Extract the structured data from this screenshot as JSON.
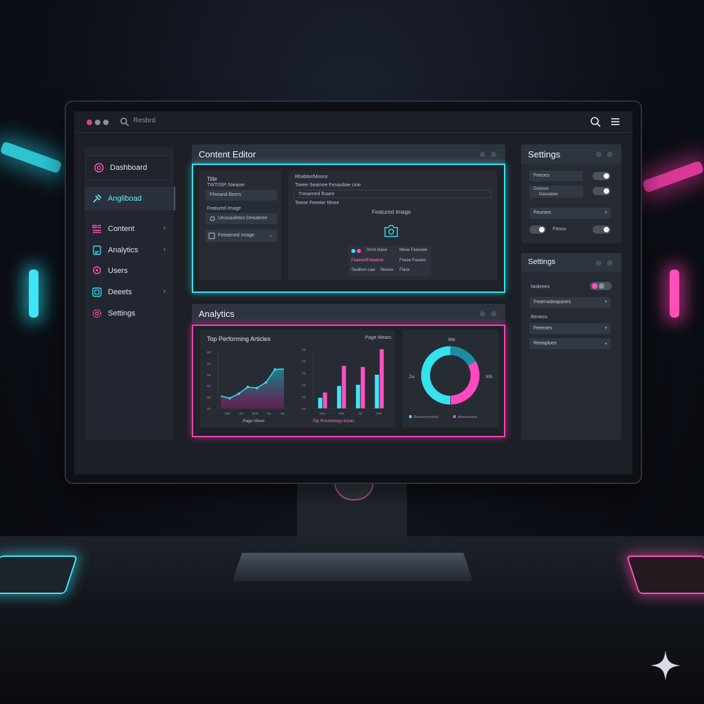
{
  "window": {
    "search_text": "Resbrd",
    "dot_colors": [
      "#d2457f",
      "#8a8f99",
      "#8a8f99"
    ]
  },
  "sidebar": {
    "items": [
      {
        "label": "Dashboard",
        "icon": "shield-icon"
      },
      {
        "label": "Angliboad",
        "icon": "pin-icon"
      },
      {
        "label": "Content",
        "icon": "content-icon"
      },
      {
        "label": "Analytics",
        "icon": "document-icon"
      },
      {
        "label": "Users",
        "icon": "user-icon"
      },
      {
        "label": "Deeets",
        "icon": "box-icon"
      },
      {
        "label": "Settings",
        "icon": "gear-icon"
      }
    ]
  },
  "content_editor": {
    "title": "Content Editor",
    "controls": "◎ ◎",
    "left": {
      "title_label": "Title",
      "title_value": "TWT0SP /loeaser",
      "field1": "Ffeeand Beers",
      "featured_label": "Featured Image",
      "field2": "Ueosauleton Deeateee",
      "field3": "Feeaened Image"
    },
    "right": {
      "header": "Rbabtor/Mooce",
      "line1": "Toeee Searnee Fenaubae cioe",
      "line2": "Tneaened fluaee",
      "line3": "Teeoe Feeeier Mnee",
      "featured_image": "Featured Image",
      "mini_table": [
        [
          "",
          "Srom Nase",
          "Mnee Feeoaee"
        ],
        [
          "Feaeeen",
          "Feeeenie",
          "Fneee Fauees"
        ],
        [
          "Sealbon ciae",
          "Slenoa",
          "Flaoe"
        ]
      ]
    }
  },
  "analytics": {
    "title": "Analytics",
    "controls": "◎ ◎"
  },
  "chart_data": [
    {
      "type": "line",
      "title": "Top Performing Articles",
      "xlabel": "Page Views",
      "x": [
        "oun",
        "ou",
        "wou",
        "ou",
        "ou"
      ],
      "y_ticks": [
        "ws",
        "oo",
        "ou",
        "oo",
        "ou",
        "oo"
      ],
      "values": [
        22,
        18,
        26,
        38,
        36,
        46,
        69,
        70
      ],
      "ylim": [
        0,
        100
      ],
      "color": "#36d9ec"
    },
    {
      "type": "bar",
      "title": "Page Wears",
      "xlabel": "Top Rocoteeeyy tntses",
      "categories": [
        "oou",
        "oou",
        "ou",
        "ooe"
      ],
      "y_ticks": [
        "ou",
        "oo",
        "ou",
        "ou",
        "ou",
        "ou"
      ],
      "series": [
        {
          "values": [
            18,
            38,
            40,
            57
          ]
        },
        {
          "values": [
            27,
            72,
            70,
            100
          ]
        }
      ],
      "ylim": [
        0,
        100
      ],
      "colors": [
        "#3fe6f5",
        "#ff4fc0"
      ]
    },
    {
      "type": "pie",
      "labels_outside": [
        "966",
        "Zio",
        "305"
      ],
      "slices": [
        {
          "name": "Bneeeeroeseb",
          "value": 50,
          "color": "#36e1f0"
        },
        {
          "name": "Aeeoeeeoe",
          "value": 33,
          "color": "#ff49c0"
        },
        {
          "name": "",
          "value": 17,
          "color": "#1c8ca2"
        }
      ]
    }
  ],
  "settings_top": {
    "title": "Settings",
    "controls": "◎ ◎",
    "rows": [
      {
        "label": "Feeoes",
        "state": "on"
      },
      {
        "label": "Dsreoxs",
        "sub": "Deecabee",
        "state": "on"
      },
      {
        "label": "Feuroes",
        "select": true
      },
      {
        "label": "Feoos",
        "state": "on"
      }
    ]
  },
  "settings_bottom": {
    "title": "Settings",
    "controls": "◎ ◎",
    "toggle_label": "Notleees",
    "select1": "Feaenadeapases",
    "section_label": "Reneos",
    "select2": "Feeeoes",
    "select3": "Reeaploes"
  }
}
